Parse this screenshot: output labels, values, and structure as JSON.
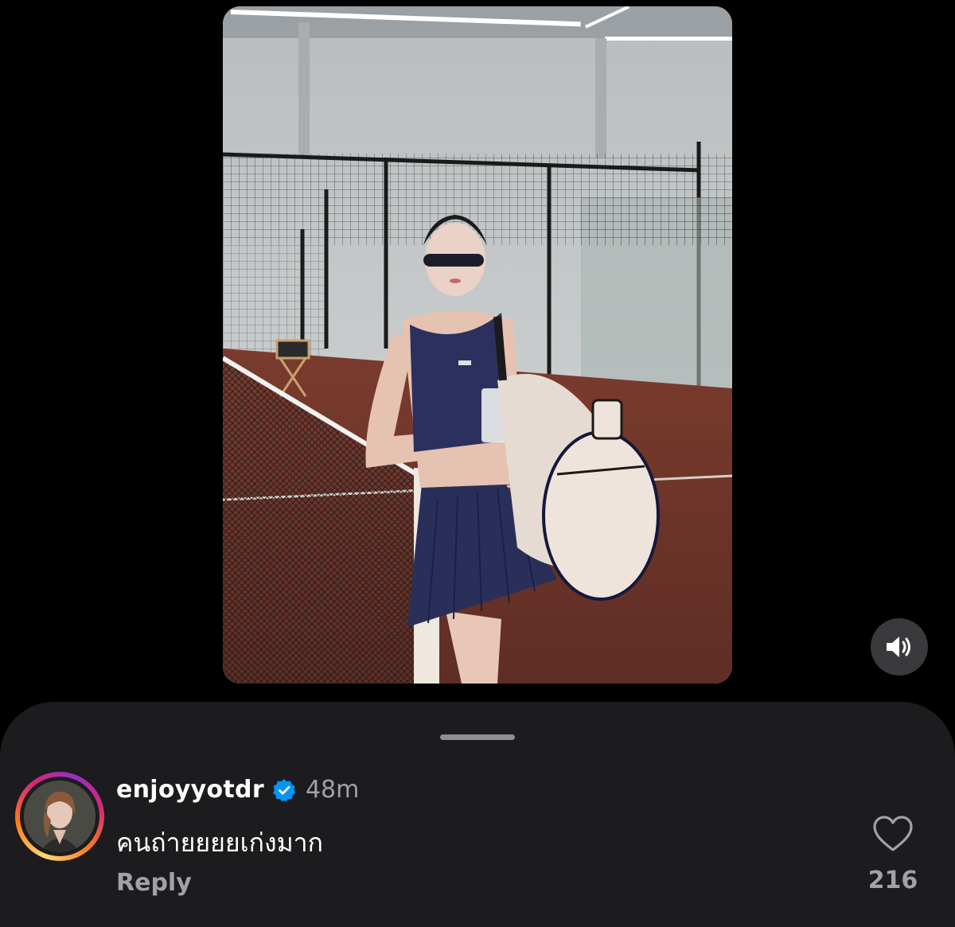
{
  "comment": {
    "username": "enjoyyotdr",
    "verified": true,
    "timestamp": "48m",
    "text": "คนถ่ายยยยเก่งมาก",
    "reply_label": "Reply",
    "like_count": "216"
  },
  "icons": {
    "sound": "speaker-on-icon",
    "like": "heart-outline-icon",
    "verified": "verified-badge-icon"
  },
  "colors": {
    "background": "#000000",
    "sheet": "#1c1c1e",
    "verified_blue": "#0095f6",
    "secondary_text": "#a1a1a6"
  }
}
